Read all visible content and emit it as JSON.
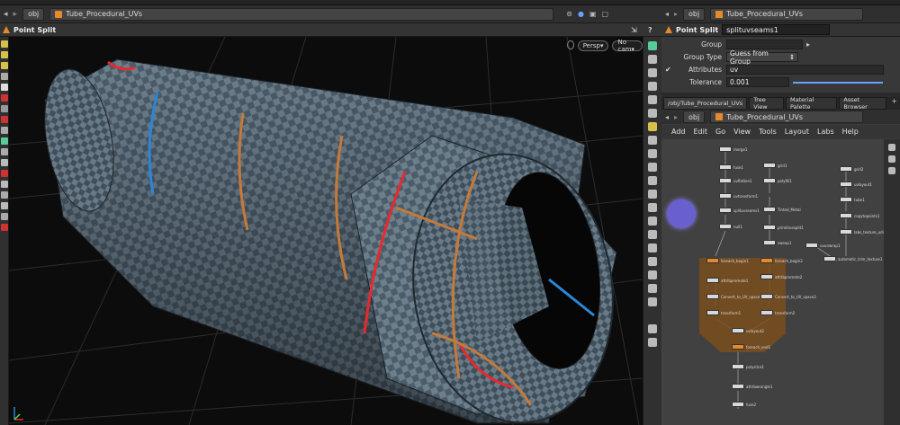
{
  "viewport": {
    "path": {
      "context": "obj",
      "node": "Tube_Procedural_UVs"
    },
    "title": "Point Split",
    "persp_label": "Persp▾",
    "cam_label": "No cam▾"
  },
  "params_panel": {
    "path": {
      "context": "obj",
      "node": "Tube_Procedural_UVs"
    },
    "node_type": "Point Split",
    "node_name": "splituvseams1",
    "rows": [
      {
        "label": "Group",
        "value": ""
      },
      {
        "label": "Group Type",
        "value": "Guess from Group"
      },
      {
        "label": "Attributes",
        "value": "uv"
      },
      {
        "label": "Tolerance",
        "value": "0.001"
      }
    ]
  },
  "network_panel": {
    "tabs": [
      "/obj/Tube_Procedural_UVs",
      "Tree View",
      "Material Palette",
      "Asset Browser"
    ],
    "path": {
      "context": "obj",
      "node": "Tube_Procedural_UVs"
    },
    "menu": [
      "Add",
      "Edit",
      "Go",
      "View",
      "Tools",
      "Layout",
      "Labs",
      "Help"
    ],
    "nodes": [
      {
        "name": "merge1"
      },
      {
        "name": "fuse1"
      },
      {
        "name": "grid1"
      },
      {
        "name": "grid2"
      },
      {
        "name": "uvflatten1"
      },
      {
        "name": "polyfill1"
      },
      {
        "name": "uvlayout1"
      },
      {
        "name": "uvtransform1"
      },
      {
        "name": "splituvseams1"
      },
      {
        "name": "Tinted_Metal"
      },
      {
        "name": "null1"
      },
      {
        "name": "primitivesplit1"
      },
      {
        "name": "sweep1"
      },
      {
        "name": "foreach_begin1"
      },
      {
        "name": "foreach_begin2"
      },
      {
        "name": "attribpromote1"
      },
      {
        "name": "attribpromote2"
      },
      {
        "name": "Convert_to_UV_space1"
      },
      {
        "name": "Convert_to_UV_space2"
      },
      {
        "name": "transform1"
      },
      {
        "name": "transform2"
      },
      {
        "name": "uvlayout2"
      },
      {
        "name": "foreach_end1"
      },
      {
        "name": "polyslice1"
      },
      {
        "name": "attribwrangle1"
      },
      {
        "name": "fuse2"
      },
      {
        "name": "labs_texture_udims1"
      },
      {
        "name": "copytopoints1"
      },
      {
        "name": "automatic_trim_texture1"
      },
      {
        "name": "uvunwrap1"
      },
      {
        "name": "tube1"
      }
    ]
  },
  "colors": {
    "seam_red": "#e8292d",
    "seam_blue": "#2b86d8",
    "seam_orange": "#c57a3a",
    "foreach_box": "#7a4e1c",
    "selected_node": "#6a5fcf"
  }
}
